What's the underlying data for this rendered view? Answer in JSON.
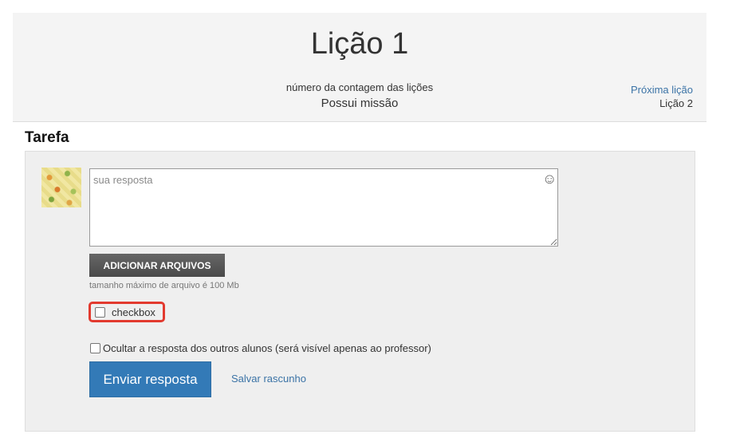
{
  "header": {
    "title": "Lição 1",
    "lesson_count_label": "número da contagem das lições",
    "mission_status": "Possui missão",
    "next_lesson_link": "Próxima lição",
    "next_lesson_name": "Lição 2"
  },
  "task": {
    "section_title": "Tarefa",
    "answer_placeholder": "sua resposta",
    "emoji_icon": "smiley-icon",
    "add_files_label": "ADICIONAR ARQUIVOS",
    "file_size_hint": "tamanho máximo de arquivo é 100 Mb",
    "checkbox_label": "checkbox",
    "hide_answers_label": "Ocultar a resposta dos outros alunos (será visível apenas ao professor)",
    "send_button": "Enviar resposta",
    "save_draft_link": "Salvar rascunho"
  },
  "colors": {
    "accent": "#337ab7",
    "link": "#3b73a6",
    "highlight": "#e23a2f"
  }
}
